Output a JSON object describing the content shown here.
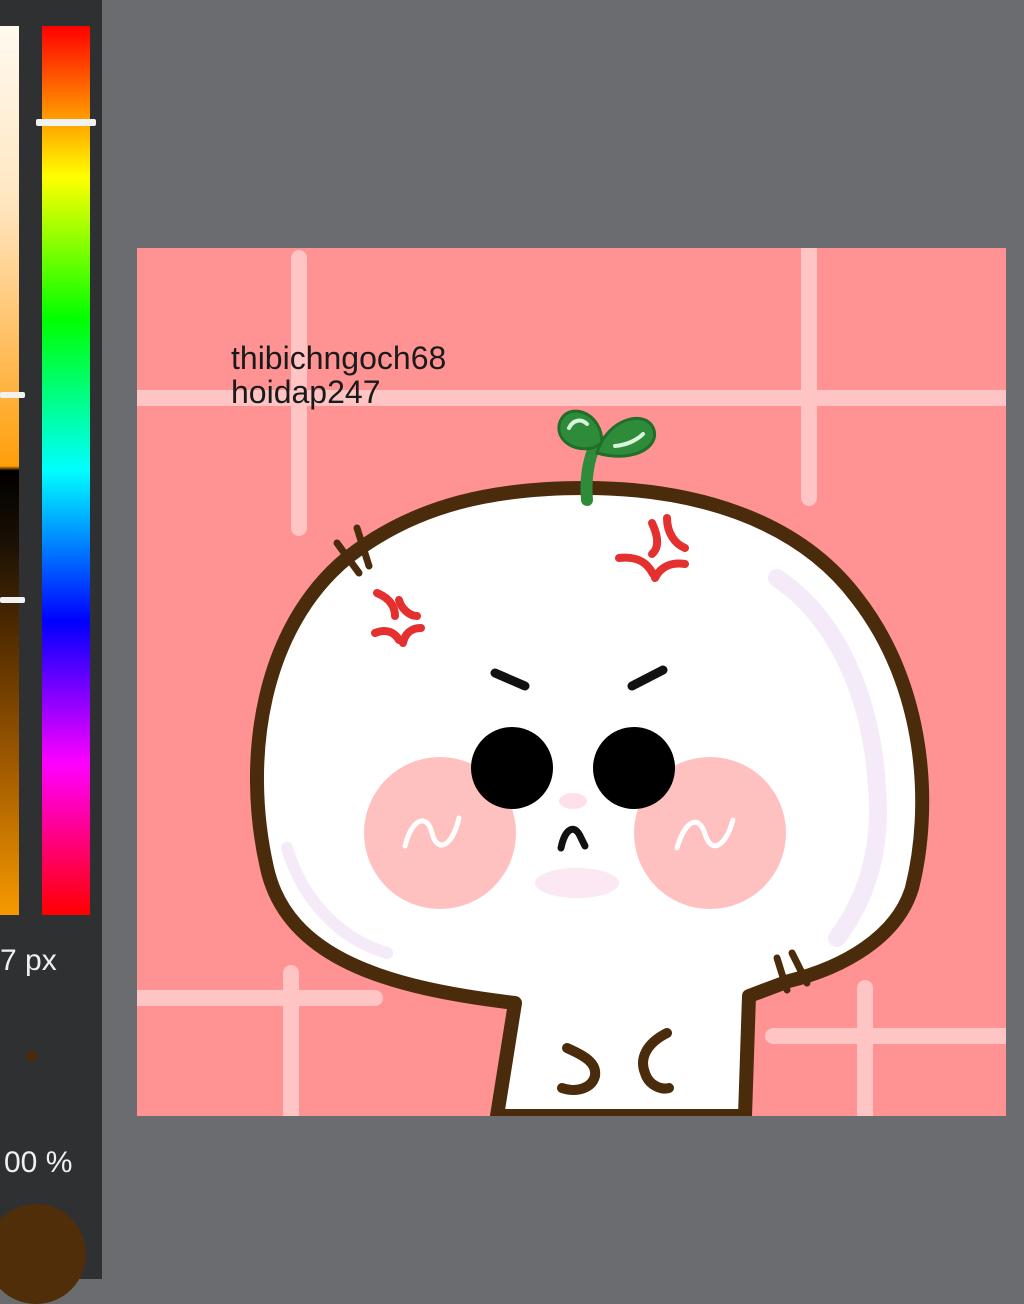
{
  "toolbar": {
    "brush_size": "7 px",
    "opacity": "00 %"
  },
  "colors": {
    "canvas_bg": "#ff9393",
    "grid_lines": "#ffc4c4",
    "outline": "#4a2c0c",
    "blush": "#ffc0c0",
    "sprout": "#2e8b3a",
    "anger_mark": "#e53030",
    "workspace": "#6a6c70",
    "panel": "#2f3032",
    "current_color": "#4f2e09"
  },
  "canvas": {
    "credit_line1": "thibichngoch68",
    "credit_line2": "hoidap247"
  }
}
